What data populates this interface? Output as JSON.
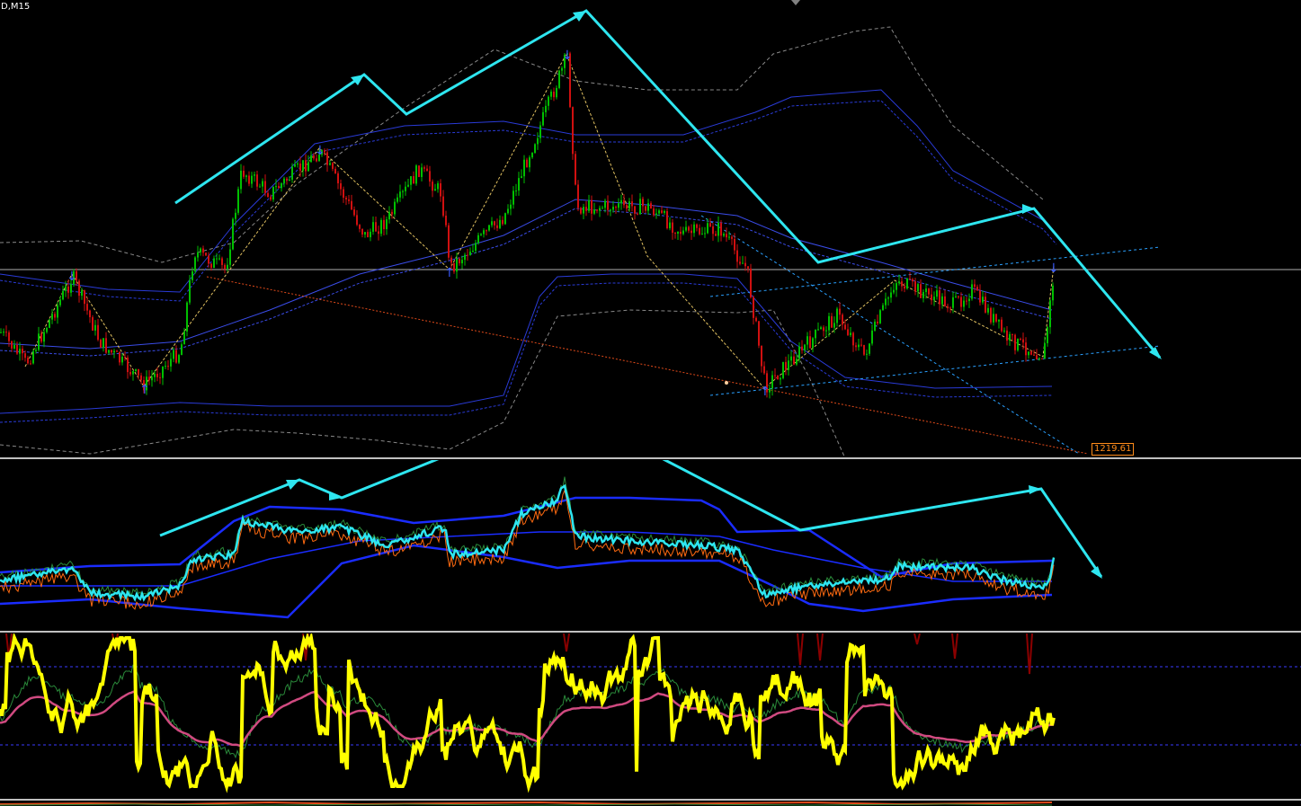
{
  "window": {
    "title": "D,M15"
  },
  "main_chart": {
    "price_label": "1219.61",
    "colors": {
      "background": "#000000",
      "bull_candle": "#00c000",
      "bear_candle": "#d01010",
      "trend_arrow": "#2ee6f0",
      "envelope_band": "#2a3bd8",
      "fractal_marker": "#3a5bff",
      "zigzag": "#e0c060",
      "channel_line": "#2aa0ff",
      "trendline_red": "#e04a1a",
      "price_label": "#ff8c1a",
      "crosshair": "#b0b0b0"
    }
  },
  "oscillator_1": {
    "colors": {
      "main_line": "#2ee6f0",
      "band": "#1a2cff",
      "signal": "#ff6a10",
      "arrow": "#2ee6f0"
    }
  },
  "oscillator_2": {
    "colors": {
      "main_line": "#ffff00",
      "ma_line": "#d04a80",
      "spikes": "#8b0000",
      "level": "#3a3aff"
    }
  }
}
